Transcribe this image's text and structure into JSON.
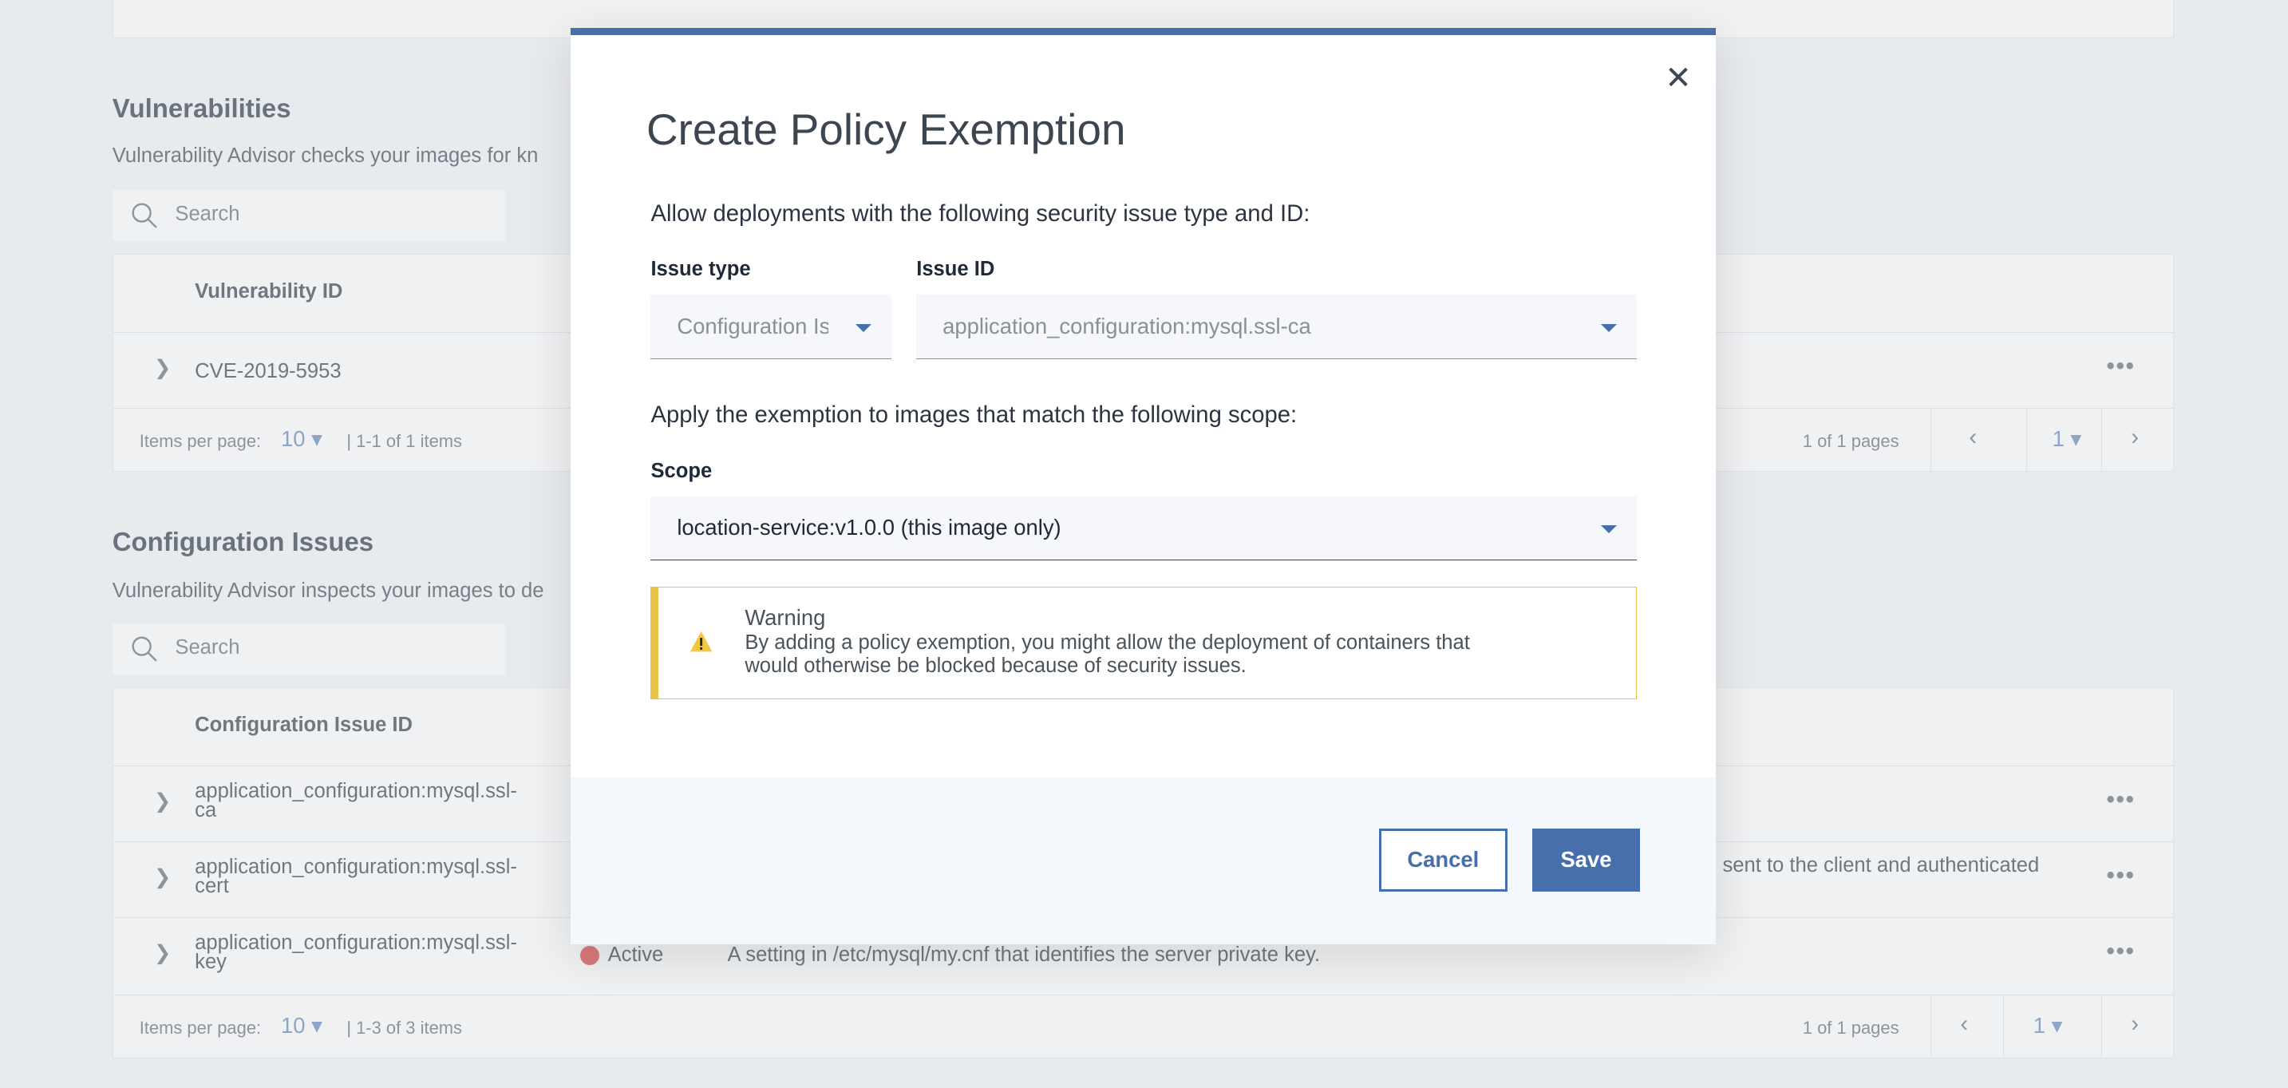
{
  "vulnerabilities": {
    "title": "Vulnerabilities",
    "description": "Vulnerability Advisor checks your images for kn",
    "search_placeholder": "Search",
    "column_header": "Vulnerability ID",
    "rows": [
      {
        "id": "CVE-2019-5953"
      }
    ],
    "footer": {
      "items_per_page_label": "Items per page:",
      "items_per_page": "10",
      "range": "1-1 of 1 items",
      "pages": "1 of 1 pages",
      "page": "1"
    }
  },
  "configuration_issues": {
    "title": "Configuration Issues",
    "description": "Vulnerability Advisor inspects your images to de",
    "search_placeholder": "Search",
    "column_header": "Configuration Issue ID",
    "rows": [
      {
        "id_line1": "application_configuration:mysql.ssl-",
        "id_line2": "ca",
        "status": "",
        "description": ""
      },
      {
        "id_line1": "application_configuration:mysql.ssl-",
        "id_line2": "cert",
        "status": "",
        "description": "sent to the client and authenticated"
      },
      {
        "id_line1": "application_configuration:mysql.ssl-",
        "id_line2": "key",
        "status": "Active",
        "description": "A setting in /etc/mysql/my.cnf that identifies the server private key."
      }
    ],
    "status_color": "#d9797c",
    "footer": {
      "items_per_page_label": "Items per page:",
      "items_per_page": "10",
      "range": "1-3 of 3 items",
      "pages": "1 of 1 pages",
      "page": "1"
    }
  },
  "modal": {
    "title": "Create Policy Exemption",
    "close_icon": "close-icon",
    "intro": "Allow deployments with the following security issue type and ID:",
    "issue_type_label": "Issue type",
    "issue_type_value": "Configuration Issues",
    "issue_id_label": "Issue ID",
    "issue_id_value": "application_configuration:mysql.ssl-ca",
    "scope_intro": "Apply the exemption to images that match the following scope:",
    "scope_label": "Scope",
    "scope_value": "location-service:v1.0.0 (this image only)",
    "warning": {
      "title": "Warning",
      "text_line1": "By adding a policy exemption, you might allow the deployment of containers that",
      "text_line2": "would otherwise be blocked because of security issues.",
      "color": "#e8c34a"
    },
    "cancel_label": "Cancel",
    "save_label": "Save",
    "accent": "#466fab"
  }
}
